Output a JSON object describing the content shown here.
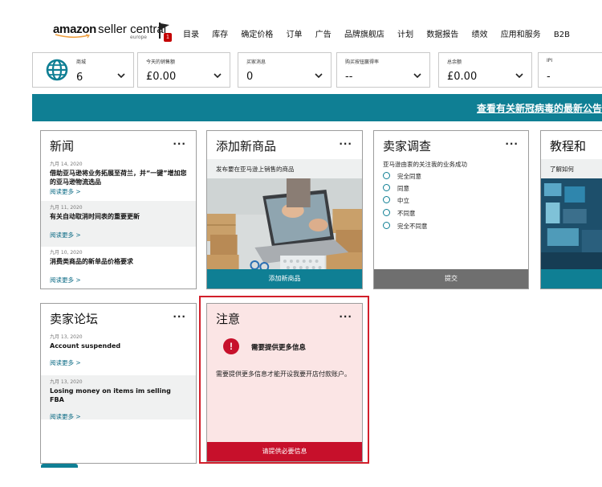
{
  "header": {
    "logo_brand": "amazon",
    "logo_product": "seller central",
    "logo_region": "europe",
    "flag_count": "1",
    "nav_items": [
      "目录",
      "库存",
      "确定价格",
      "订单",
      "广告",
      "品牌旗舰店",
      "计划",
      "数据报告",
      "绩效",
      "应用和服务",
      "B2B"
    ]
  },
  "metrics": [
    {
      "label": "商城",
      "value": "6",
      "icon": "globe-icon"
    },
    {
      "label": "今天的销售额",
      "value": "£0.00"
    },
    {
      "label": "买家消息",
      "value": "0"
    },
    {
      "label": "购买按钮赢得率",
      "value": "--"
    },
    {
      "label": "总余额",
      "value": "£0.00"
    },
    {
      "label": "IPI",
      "value": "-"
    }
  ],
  "banner": {
    "text": "查看有关新冠病毒的最新公告"
  },
  "cards": {
    "news": {
      "title": "新闻",
      "more": "···",
      "items": [
        {
          "date": "九月 14, 2020",
          "headline": "借助亚马逊将业务拓展至荷兰，并“一键”增加您的亚马逊物流选品",
          "link": "阅读更多 >"
        },
        {
          "date": "九月 11, 2020",
          "headline": "有关自动取消时间表的重要更新",
          "link": "阅读更多 >"
        },
        {
          "date": "九月 10, 2020",
          "headline": "消费类商品的新单品价格要求",
          "link": "阅读更多 >"
        }
      ]
    },
    "add_product": {
      "title": "添加新商品",
      "more": "···",
      "description": "发布要在亚马逊上销售的商品",
      "button": "添加新商品"
    },
    "survey": {
      "title": "卖家调查",
      "more": "···",
      "question": "亚马逊由衷的关注我的业务成功",
      "options": [
        "完全同意",
        "同意",
        "中立",
        "不同意",
        "完全不同意"
      ],
      "button": "提交"
    },
    "tutorial": {
      "title": "教程和",
      "description": "了解如何"
    },
    "forum": {
      "title": "卖家论坛",
      "more": "···",
      "items": [
        {
          "date": "九月 13, 2020",
          "headline": "Account suspended",
          "link": "阅读更多 >"
        },
        {
          "date": "九月 13, 2020",
          "headline": "Losing money on items im selling FBA",
          "link": "阅读更多 >"
        }
      ]
    },
    "notice": {
      "title": "注意",
      "more": "···",
      "alert_title": "需要提供更多信息",
      "body": "需要提供更多信息才能开设我要开店付款账户。",
      "button": "请提供必要信息"
    }
  },
  "colors": {
    "teal": "#0f7f94",
    "red": "#c7102b",
    "notice_bg": "#fbe5e5",
    "highlight": "#d21f2b"
  }
}
